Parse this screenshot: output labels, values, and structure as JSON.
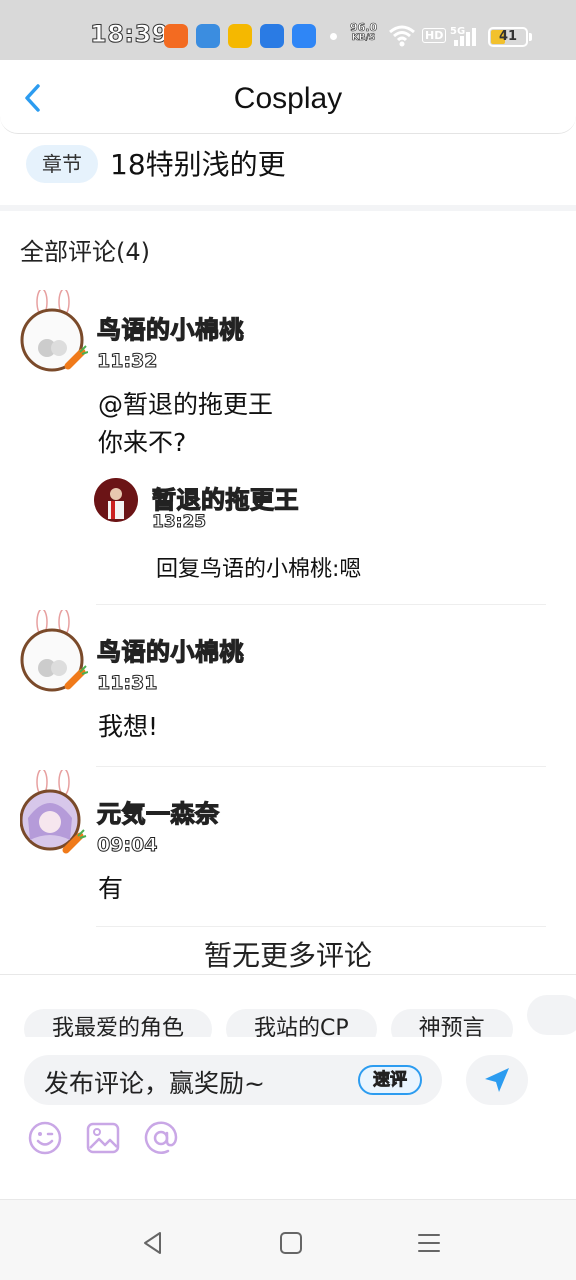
{
  "status_bar": {
    "time": "18:39",
    "net_speed_value": "96.0",
    "net_speed_unit": "KB/S",
    "hd_label": "HD",
    "battery": "41",
    "battery_level": 0.41,
    "app_icon_colors": [
      "#f36b21",
      "#3b8de0",
      "#f5b800",
      "#2a7be4",
      "#2f86f6"
    ]
  },
  "header": {
    "title": "Cosplay",
    "back_icon": "chevron-left-icon"
  },
  "chapter": {
    "tag": "章节",
    "name": "18特别浅的更"
  },
  "comments_header": "全部评论(4)",
  "comments": [
    {
      "user": "鸟语的小棉桃",
      "time": "11:32",
      "text": "@暂退的拖更王\n你来不?",
      "reply": {
        "user": "暂退的拖更王",
        "time": "13:25",
        "text": "回复鸟语的小棉桃:嗯"
      }
    },
    {
      "user": "鸟语的小棉桃",
      "time": "11:31",
      "text": "我想!"
    },
    {
      "user": "元気一森奈",
      "time": "09:04",
      "text": "有"
    }
  ],
  "no_more_text": "暂无更多评论",
  "input_panel": {
    "quick_tags": [
      "我最爱的角色",
      "我站的CP",
      "神预言",
      ""
    ],
    "placeholder": "发布评论，赢奖励~",
    "quick_review": "速评",
    "tools": [
      "emoji-icon",
      "image-icon",
      "at-icon"
    ]
  },
  "colors": {
    "accent": "#2c9cf0",
    "tool_icon": "#c9a7e6",
    "chapter_tag_bg": "#e6f2fc"
  }
}
